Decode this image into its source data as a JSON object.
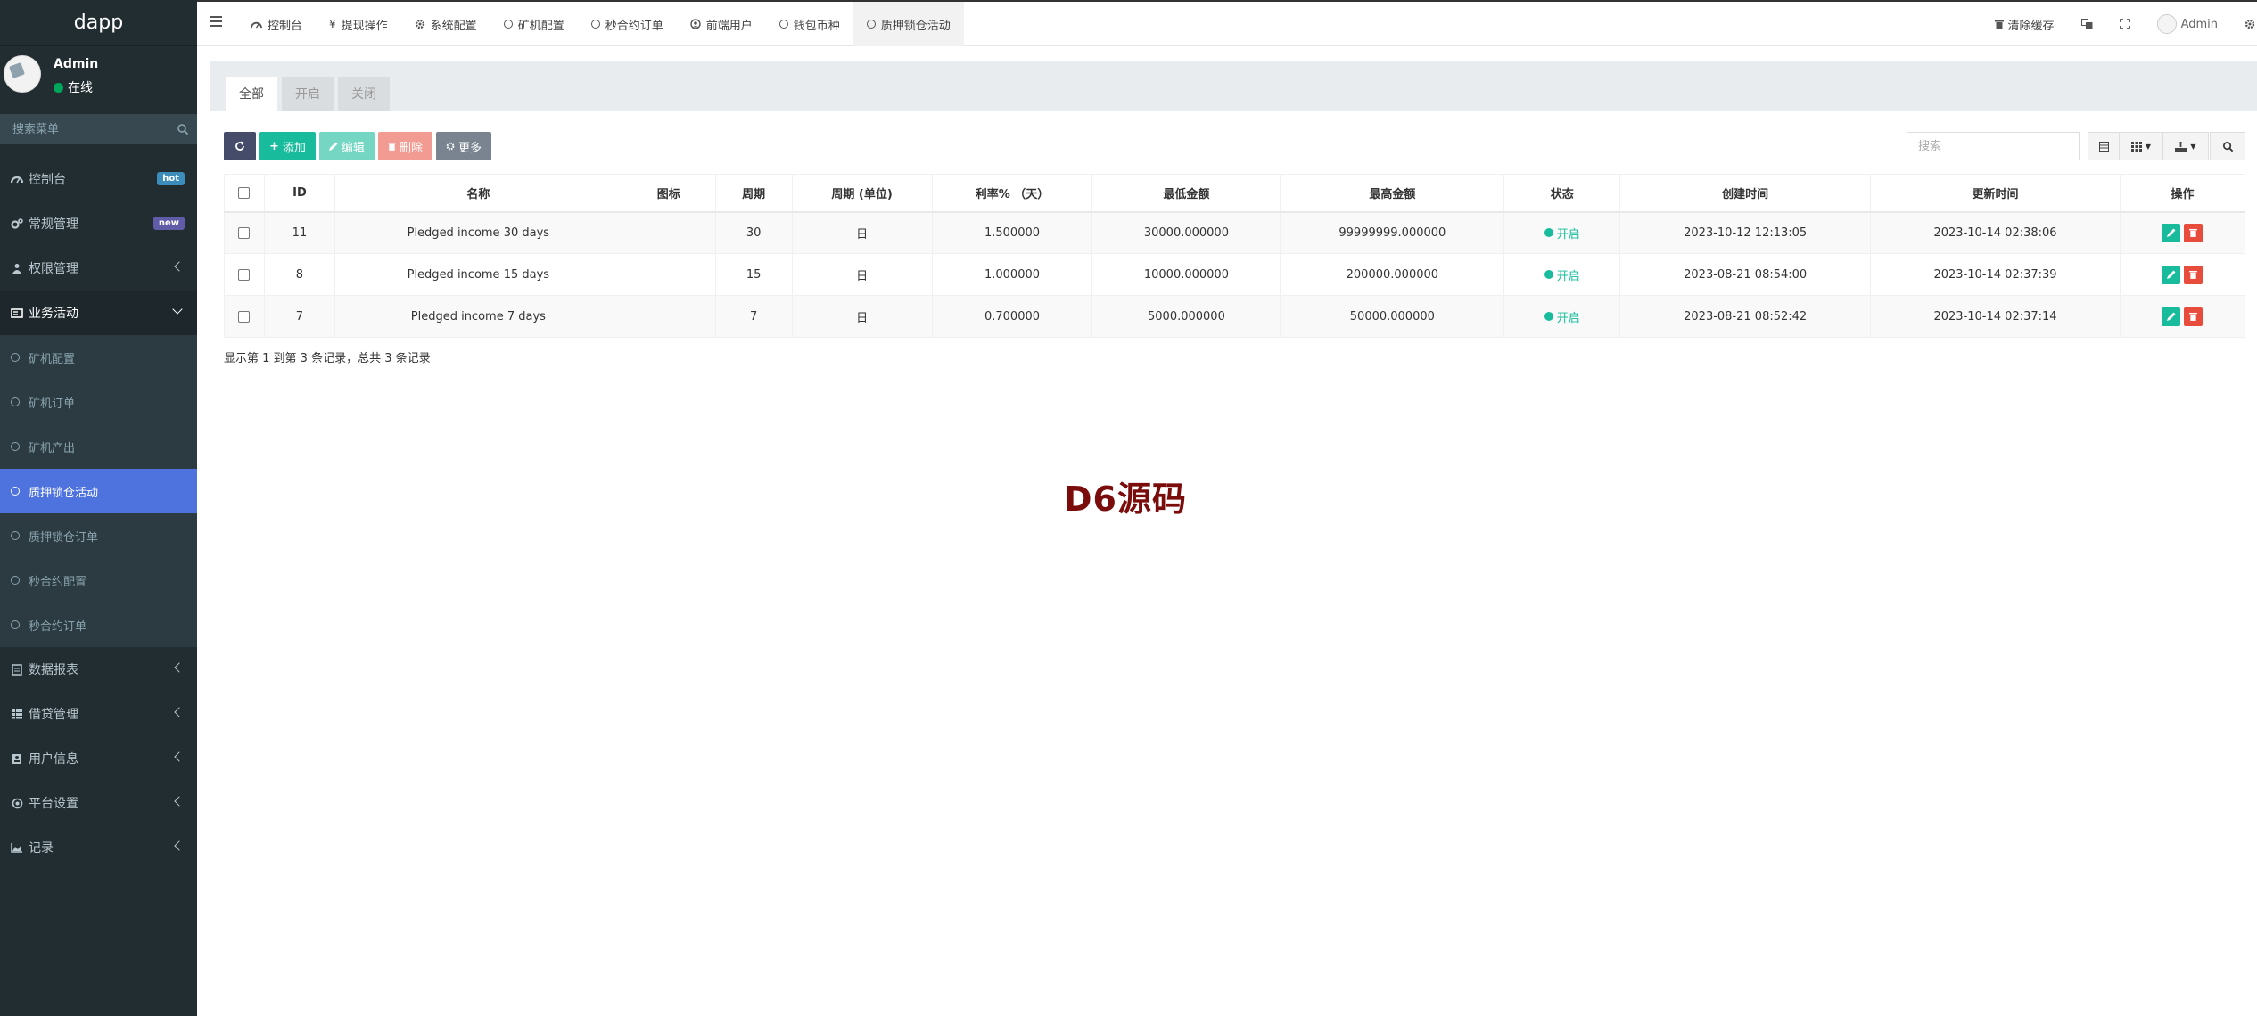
{
  "brand": "dapp",
  "user": {
    "name": "Admin",
    "status": "在线"
  },
  "sidebar": {
    "search_placeholder": "搜索菜单",
    "menu": [
      {
        "label": "控制台",
        "icon": "dashboard-icon",
        "badge": "hot"
      },
      {
        "label": "常规管理",
        "icon": "cogs-icon",
        "badge": "new"
      },
      {
        "label": "权限管理",
        "icon": "group-icon"
      },
      {
        "label": "业务活动",
        "icon": "business-icon",
        "expanded": true
      }
    ],
    "submenu": [
      {
        "label": "矿机配置"
      },
      {
        "label": "矿机订单"
      },
      {
        "label": "矿机产出"
      },
      {
        "label": "质押锁仓活动",
        "active": true
      },
      {
        "label": "质押锁仓订单"
      },
      {
        "label": "秒合约配置"
      },
      {
        "label": "秒合约订单"
      }
    ],
    "menu2": [
      {
        "label": "数据报表",
        "icon": "report-icon"
      },
      {
        "label": "借贷管理",
        "icon": "loan-icon"
      },
      {
        "label": "用户信息",
        "icon": "user-book-icon"
      },
      {
        "label": "平台设置",
        "icon": "platform-settings-icon"
      },
      {
        "label": "记录",
        "icon": "area-chart-icon"
      }
    ]
  },
  "topbar": {
    "tabs": [
      {
        "label": "控制台",
        "icon": "dashboard-icon"
      },
      {
        "label": "提现操作",
        "icon": "yen-icon"
      },
      {
        "label": "系统配置",
        "icon": "gear-icon"
      },
      {
        "label": "矿机配置",
        "icon": "circle-icon"
      },
      {
        "label": "秒合约订单",
        "icon": "circle-icon"
      },
      {
        "label": "前端用户",
        "icon": "user-circle-icon"
      },
      {
        "label": "钱包币种",
        "icon": "circle-icon"
      },
      {
        "label": "质押锁仓活动",
        "icon": "circle-icon",
        "active": true
      }
    ],
    "clear_cache": "清除缓存",
    "admin": "Admin"
  },
  "panel": {
    "tabs": [
      "全部",
      "开启",
      "关闭"
    ],
    "toolbar": {
      "add": "添加",
      "edit": "编辑",
      "delete": "删除",
      "more": "更多"
    },
    "search_placeholder": "搜索",
    "columns": [
      "ID",
      "名称",
      "图标",
      "周期",
      "周期 (单位)",
      "利率% （天）",
      "最低金额",
      "最高金额",
      "状态",
      "创建时间",
      "更新时间",
      "操作"
    ],
    "rows": [
      {
        "id": "11",
        "name": "Pledged income 30 days",
        "icon": "",
        "period": "30",
        "unit": "日",
        "rate": "1.500000",
        "min": "30000.000000",
        "max": "99999999.000000",
        "status": "开启",
        "created": "2023-10-12 12:13:05",
        "updated": "2023-10-14 02:38:06"
      },
      {
        "id": "8",
        "name": "Pledged income 15 days",
        "icon": "",
        "period": "15",
        "unit": "日",
        "rate": "1.000000",
        "min": "10000.000000",
        "max": "200000.000000",
        "status": "开启",
        "created": "2023-08-21 08:54:00",
        "updated": "2023-10-14 02:37:39"
      },
      {
        "id": "7",
        "name": "Pledged income 7 days",
        "icon": "",
        "period": "7",
        "unit": "日",
        "rate": "0.700000",
        "min": "5000.000000",
        "max": "50000.000000",
        "status": "开启",
        "created": "2023-08-21 08:52:42",
        "updated": "2023-10-14 02:37:14"
      }
    ],
    "footer": "显示第 1 到第 3 条记录，总共 3 条记录"
  },
  "watermark": "D6源码",
  "colors": {
    "sidebar": "#222d32",
    "active": "#4e73df",
    "green": "#18bc9c",
    "red": "#e74c3c"
  }
}
